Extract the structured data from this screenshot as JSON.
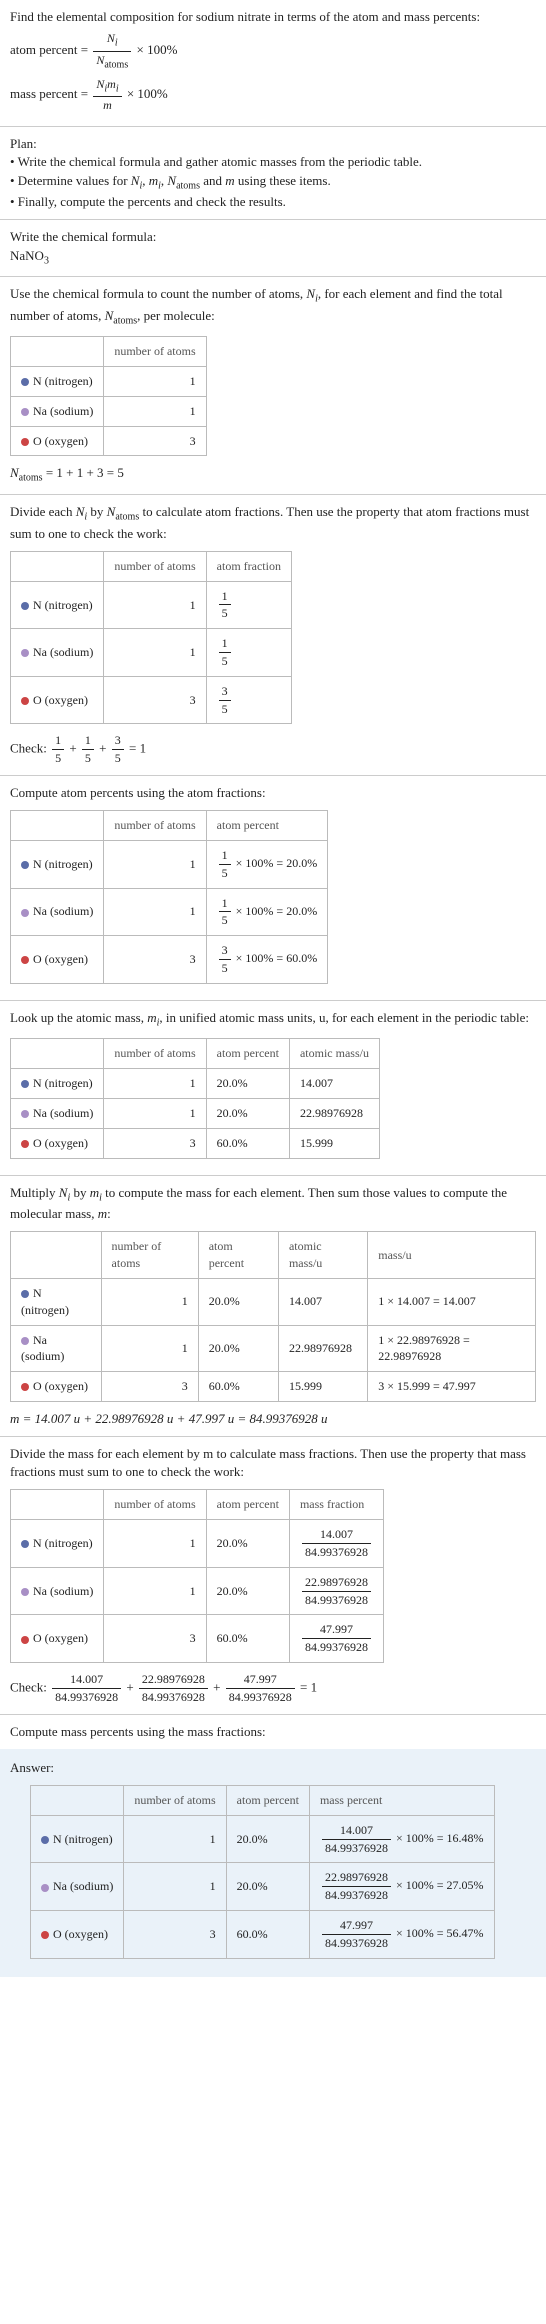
{
  "intro": {
    "line1": "Find the elemental composition for sodium nitrate in terms of the atom and mass percents:",
    "atom_percent_label": "atom percent = ",
    "atom_percent_tail": " × 100%",
    "mass_percent_label": "mass percent = ",
    "mass_percent_tail": " × 100%",
    "frac_ap_num": "N",
    "frac_ap_num_sub": "i",
    "frac_ap_den": "N",
    "frac_ap_den_sub": "atoms",
    "frac_mp_num": "N",
    "frac_mp_num_sub": "i",
    "frac_mp_num2": "m",
    "frac_mp_num2_sub": "i",
    "frac_mp_den": "m"
  },
  "plan": {
    "heading": "Plan:",
    "b1": "• Write the chemical formula and gather atomic masses from the periodic table.",
    "b2_pre": "• Determine values for ",
    "b2_post": " using these items.",
    "b3": "• Finally, compute the percents and check the results."
  },
  "step1": {
    "heading": "Write the chemical formula:",
    "formula": "NaNO",
    "formula_sub": "3"
  },
  "step2": {
    "text_pre": "Use the chemical formula to count the number of atoms, ",
    "text_mid": ", for each element and find the total number of atoms, ",
    "text_post": ", per molecule:",
    "col1": "",
    "col2": "number of atoms",
    "n_name": "N (nitrogen)",
    "n_count": "1",
    "na_name": "Na (sodium)",
    "na_count": "1",
    "o_name": "O (oxygen)",
    "o_count": "3",
    "total_pre": "N",
    "total_sub": "atoms",
    "total_eq": " = 1 + 1 + 3 = 5"
  },
  "step3": {
    "text_pre": "Divide each ",
    "text_mid": " by ",
    "text_post": " to calculate atom fractions. Then use the property that atom fractions must sum to one to check the work:",
    "col1": "",
    "col2": "number of atoms",
    "col3": "atom fraction",
    "n_count": "1",
    "n_frac_num": "1",
    "n_frac_den": "5",
    "na_count": "1",
    "na_frac_num": "1",
    "na_frac_den": "5",
    "o_count": "3",
    "o_frac_num": "3",
    "o_frac_den": "5",
    "check_label": "Check: ",
    "check_eq": " = 1"
  },
  "step4": {
    "heading": "Compute atom percents using the atom fractions:",
    "col1": "",
    "col2": "number of atoms",
    "col3": "atom percent",
    "n_count": "1",
    "n_calc": " × 100% = 20.0%",
    "n_num": "1",
    "n_den": "5",
    "na_count": "1",
    "na_calc": " × 100% = 20.0%",
    "na_num": "1",
    "na_den": "5",
    "o_count": "3",
    "o_calc": " × 100% = 60.0%",
    "o_num": "3",
    "o_den": "5"
  },
  "step5": {
    "text_pre": "Look up the atomic mass, ",
    "text_post": ", in unified atomic mass units, u, for each element in the periodic table:",
    "col2": "number of atoms",
    "col3": "atom percent",
    "col4": "atomic mass/u",
    "n_count": "1",
    "n_pct": "20.0%",
    "n_mass": "14.007",
    "na_count": "1",
    "na_pct": "20.0%",
    "na_mass": "22.98976928",
    "o_count": "3",
    "o_pct": "60.0%",
    "o_mass": "15.999"
  },
  "step6": {
    "text_pre": "Multiply ",
    "text_mid": " by ",
    "text_mid2": " to compute the mass for each element. Then sum those values to compute the molecular mass, ",
    "text_post": ":",
    "col2": "number of atoms",
    "col3": "atom percent",
    "col4": "atomic mass/u",
    "col5": "mass/u",
    "n_count": "1",
    "n_pct": "20.0%",
    "n_mass": "14.007",
    "n_calc": "1 × 14.007 = 14.007",
    "na_count": "1",
    "na_pct": "20.0%",
    "na_mass": "22.98976928",
    "na_calc": "1 × 22.98976928 = 22.98976928",
    "o_count": "3",
    "o_pct": "60.0%",
    "o_mass": "15.999",
    "o_calc": "3 × 15.999 = 47.997",
    "total": "m = 14.007 u + 22.98976928 u + 47.997 u = 84.99376928 u"
  },
  "step7": {
    "text": "Divide the mass for each element by m to calculate mass fractions. Then use the property that mass fractions must sum to one to check the work:",
    "col2": "number of atoms",
    "col3": "atom percent",
    "col4": "mass fraction",
    "n_count": "1",
    "n_pct": "20.0%",
    "n_num": "14.007",
    "n_den": "84.99376928",
    "na_count": "1",
    "na_pct": "20.0%",
    "na_num": "22.98976928",
    "na_den": "84.99376928",
    "o_count": "3",
    "o_pct": "60.0%",
    "o_num": "47.997",
    "o_den": "84.99376928",
    "check_label": "Check: ",
    "check_eq": " = 1"
  },
  "step8": {
    "heading": "Compute mass percents using the mass fractions:",
    "answer_label": "Answer:",
    "col2": "number of atoms",
    "col3": "atom percent",
    "col4": "mass percent",
    "n_count": "1",
    "n_pct": "20.0%",
    "n_num": "14.007",
    "n_den": "84.99376928",
    "n_tail": " × 100% = 16.48%",
    "na_count": "1",
    "na_pct": "20.0%",
    "na_num": "22.98976928",
    "na_den": "84.99376928",
    "na_tail": " × 100% = 27.05%",
    "o_count": "3",
    "o_pct": "60.0%",
    "o_num": "47.997",
    "o_den": "84.99376928",
    "o_tail": " × 100% = 56.47%"
  },
  "elem": {
    "n": "N (nitrogen)",
    "na": "Na (sodium)",
    "o": "O (oxygen)"
  }
}
